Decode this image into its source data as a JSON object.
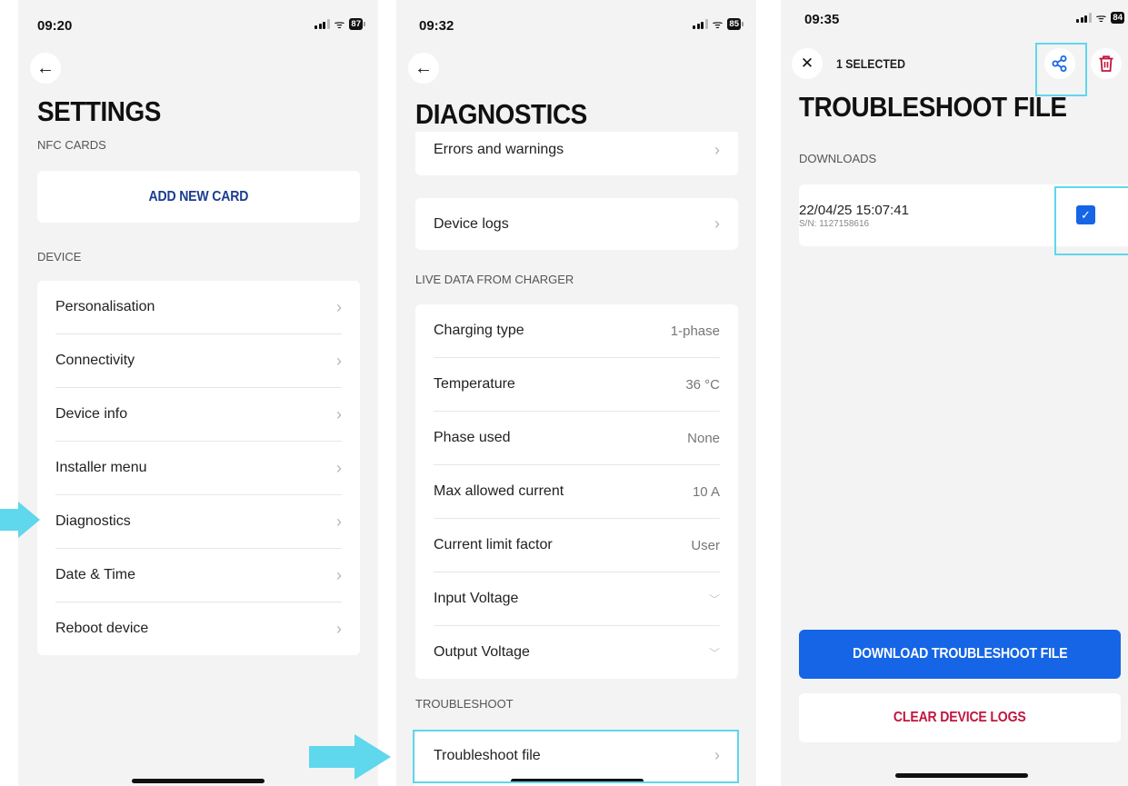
{
  "screen1": {
    "time": "09:20",
    "battery": "87",
    "title": "SETTINGS",
    "nfc_label": "NFC CARDS",
    "add_card": "ADD NEW CARD",
    "device_label": "DEVICE",
    "items": [
      "Personalisation",
      "Connectivity",
      "Device info",
      "Installer menu",
      "Diagnostics",
      "Date & Time",
      "Reboot device"
    ]
  },
  "screen2": {
    "time": "09:32",
    "battery": "85",
    "title": "DIAGNOSTICS",
    "errors_label": "Errors and warnings",
    "logs_label": "Device logs",
    "live_label": "LIVE DATA FROM CHARGER",
    "live": [
      {
        "label": "Charging type",
        "value": "1-phase"
      },
      {
        "label": "Temperature",
        "value": "36 °C"
      },
      {
        "label": "Phase used",
        "value": "None"
      },
      {
        "label": "Max allowed current",
        "value": "10 A"
      },
      {
        "label": "Current limit factor",
        "value": "User"
      },
      {
        "label": "Input Voltage",
        "value": ""
      },
      {
        "label": "Output Voltage",
        "value": ""
      }
    ],
    "troubleshoot_label": "TROUBLESHOOT",
    "troubleshoot_item": "Troubleshoot file"
  },
  "screen3": {
    "time": "09:35",
    "battery": "84",
    "selected": "1 SELECTED",
    "title": "TROUBLESHOOT FILE",
    "downloads_label": "DOWNLOADS",
    "file_date": "22/04/25 15:07:41",
    "file_sn": "S/N: 1127158616",
    "download_btn": "DOWNLOAD TROUBLESHOOT FILE",
    "clear_btn": "CLEAR DEVICE LOGS"
  },
  "icons": {
    "chevron": "›",
    "chevron_down": "⌄",
    "back": "←",
    "close": "✕",
    "check": "✓"
  },
  "colors": {
    "primary_blue": "#1565e6",
    "danger": "#c0163f",
    "highlight": "#5fd7ec",
    "background": "#f3f3f4"
  }
}
